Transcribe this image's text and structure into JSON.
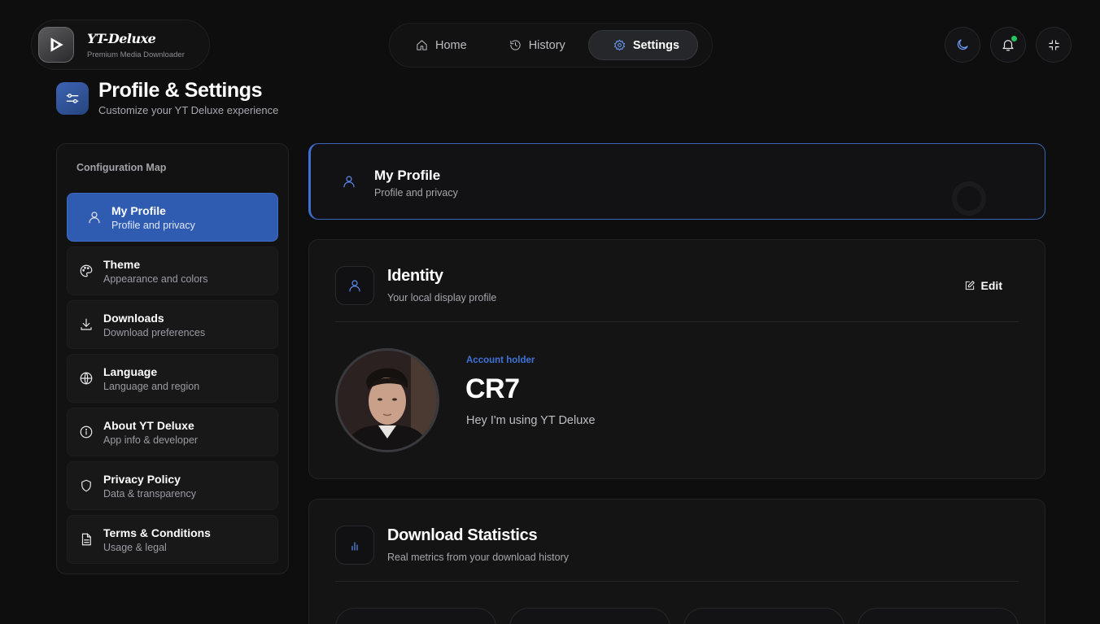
{
  "brand": {
    "name": "YT-Deluxe",
    "tagline": "Premium Media Downloader"
  },
  "nav": {
    "tabs": [
      {
        "label": "Home",
        "icon": "home-icon"
      },
      {
        "label": "History",
        "icon": "history-icon"
      },
      {
        "label": "Settings",
        "icon": "gear-icon",
        "active": true
      }
    ]
  },
  "header_actions": [
    "moon-icon",
    "bell-icon",
    "minimize-icon"
  ],
  "page": {
    "title": "Profile & Settings",
    "subtitle": "Customize your YT Deluxe experience"
  },
  "sidebar": {
    "heading": "Configuration Map",
    "items": [
      {
        "label": "My Profile",
        "desc": "Profile and privacy",
        "icon": "user-icon",
        "active": true
      },
      {
        "label": "Theme",
        "desc": "Appearance and colors",
        "icon": "palette-icon"
      },
      {
        "label": "Downloads",
        "desc": "Download preferences",
        "icon": "download-icon"
      },
      {
        "label": "Language",
        "desc": "Language and region",
        "icon": "globe-icon"
      },
      {
        "label": "About YT Deluxe",
        "desc": "App info & developer",
        "icon": "info-icon"
      },
      {
        "label": "Privacy Policy",
        "desc": "Data & transparency",
        "icon": "shield-icon"
      },
      {
        "label": "Terms & Conditions",
        "desc": "Usage & legal",
        "icon": "document-icon"
      }
    ]
  },
  "section_header": {
    "title": "My Profile",
    "subtitle": "Profile and privacy"
  },
  "identity": {
    "title": "Identity",
    "subtitle": "Your local display profile",
    "edit_label": "Edit",
    "account_label": "Account holder",
    "display_name": "CR7",
    "bio": "Hey I'm using YT Deluxe"
  },
  "stats": {
    "title": "Download Statistics",
    "subtitle": "Real metrics from your download history"
  },
  "colors": {
    "accent": "#2f5bb0",
    "accent_text": "#3f73d8",
    "online": "#22c55e",
    "background": "#0e0e0f"
  }
}
